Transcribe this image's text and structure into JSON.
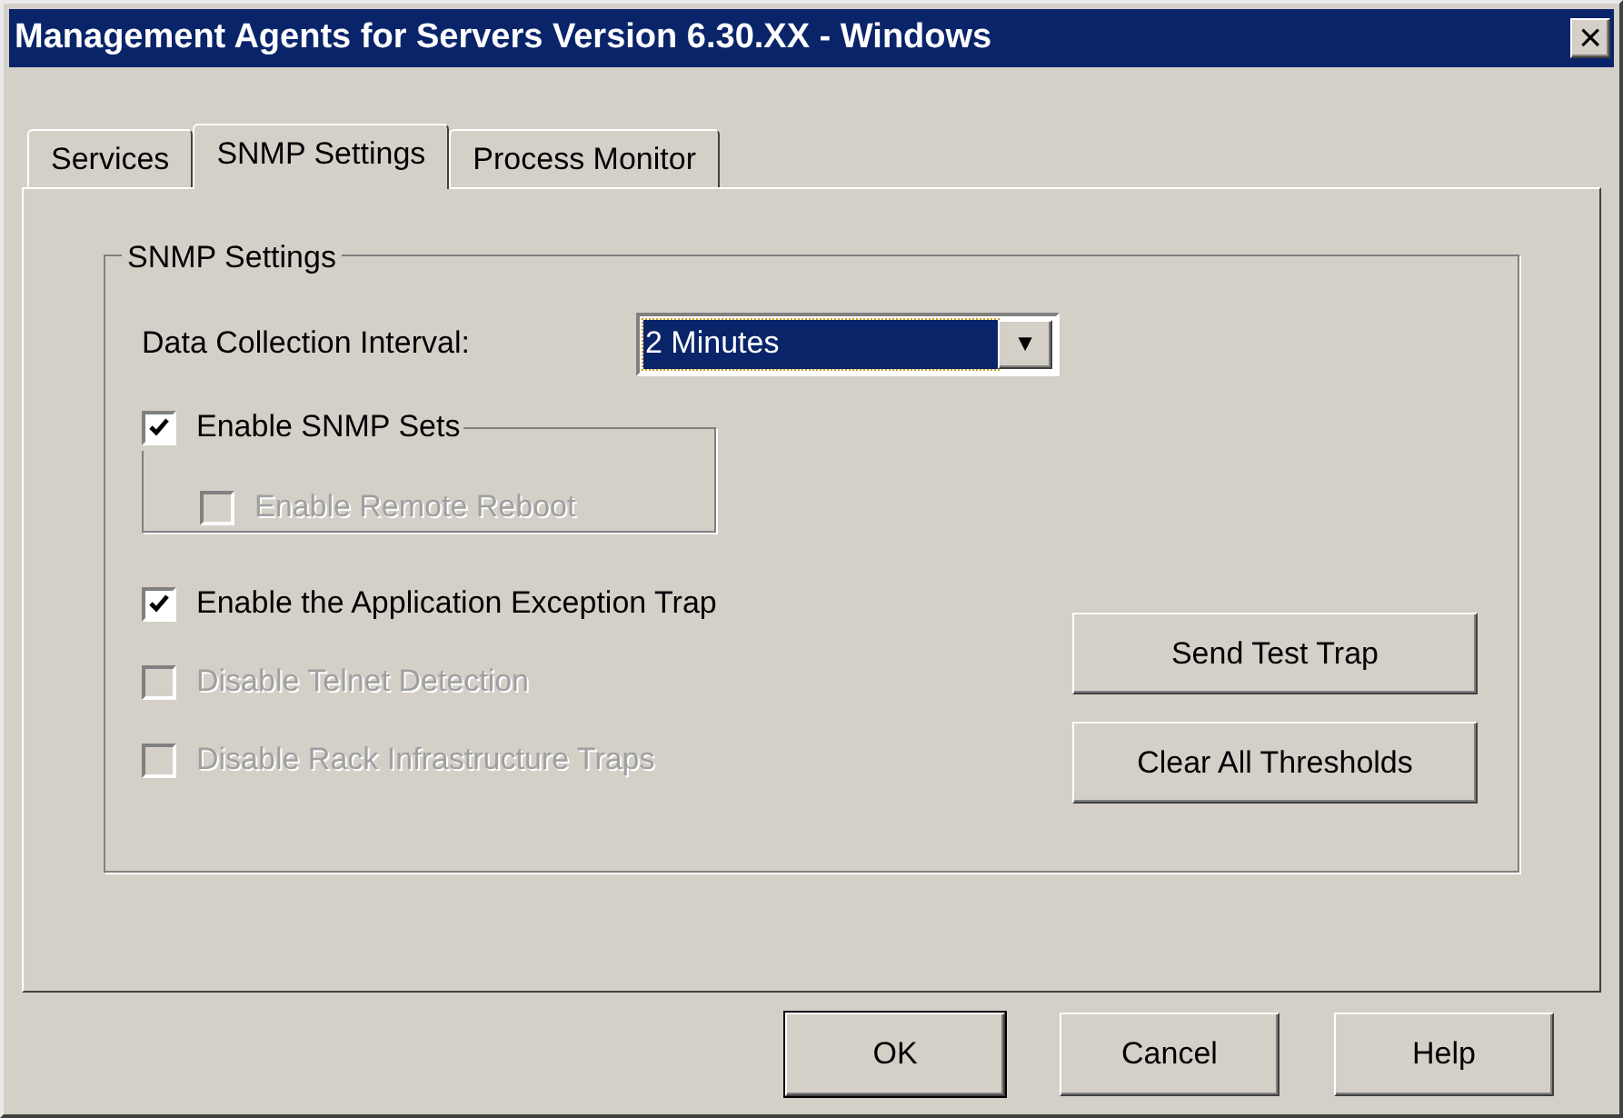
{
  "window": {
    "title": "Management Agents for Servers Version 6.30.XX - Windows",
    "close": "×"
  },
  "tabs": [
    {
      "label": "Services",
      "selected": false
    },
    {
      "label": "SNMP Settings",
      "selected": true
    },
    {
      "label": "Process Monitor",
      "selected": false
    }
  ],
  "group": {
    "title": "SNMP Settings",
    "interval": {
      "label": "Data Collection Interval:",
      "value": "2 Minutes",
      "arrow": "▼"
    },
    "snmp_sets": {
      "label": "Enable SNMP Sets",
      "checked": true,
      "disabled": false,
      "sub": {
        "label": "Enable Remote Reboot",
        "checked": false,
        "disabled": true
      }
    },
    "options": [
      {
        "label": "Enable the Application Exception Trap",
        "checked": true,
        "disabled": false
      },
      {
        "label": "Disable Telnet Detection",
        "checked": false,
        "disabled": true
      },
      {
        "label": "Disable Rack Infrastructure Traps",
        "checked": false,
        "disabled": true
      }
    ],
    "buttons": [
      {
        "label": "Send Test Trap"
      },
      {
        "label": "Clear All Thresholds"
      }
    ]
  },
  "buttons": [
    {
      "label": "OK",
      "default": true
    },
    {
      "label": "Cancel",
      "default": false
    },
    {
      "label": "Help",
      "default": false
    }
  ]
}
